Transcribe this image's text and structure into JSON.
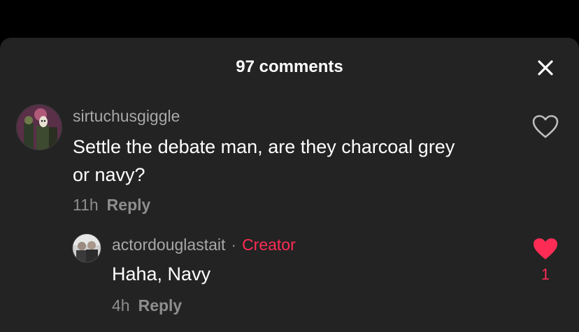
{
  "header": {
    "title": "97 comments",
    "close_icon": "close-icon"
  },
  "comments": [
    {
      "username": "sirtuchusgiggle",
      "text_line1": "Settle the debate man, are they charcoal grey",
      "text_line2": "or navy?",
      "time": "11h",
      "reply_label": "Reply",
      "liked": false,
      "like_icon": "heart-outline-icon"
    }
  ],
  "replies": [
    {
      "username": "actordouglastait",
      "separator": "·",
      "badge": "Creator",
      "text": "Haha, Navy",
      "time": "4h",
      "reply_label": "Reply",
      "liked": true,
      "like_icon": "heart-filled-icon",
      "like_count": "1"
    }
  ],
  "colors": {
    "background": "#000000",
    "sheet": "#232323",
    "accent": "#fe2c55",
    "text_primary": "#ffffff",
    "text_secondary": "#a8a8a8"
  }
}
